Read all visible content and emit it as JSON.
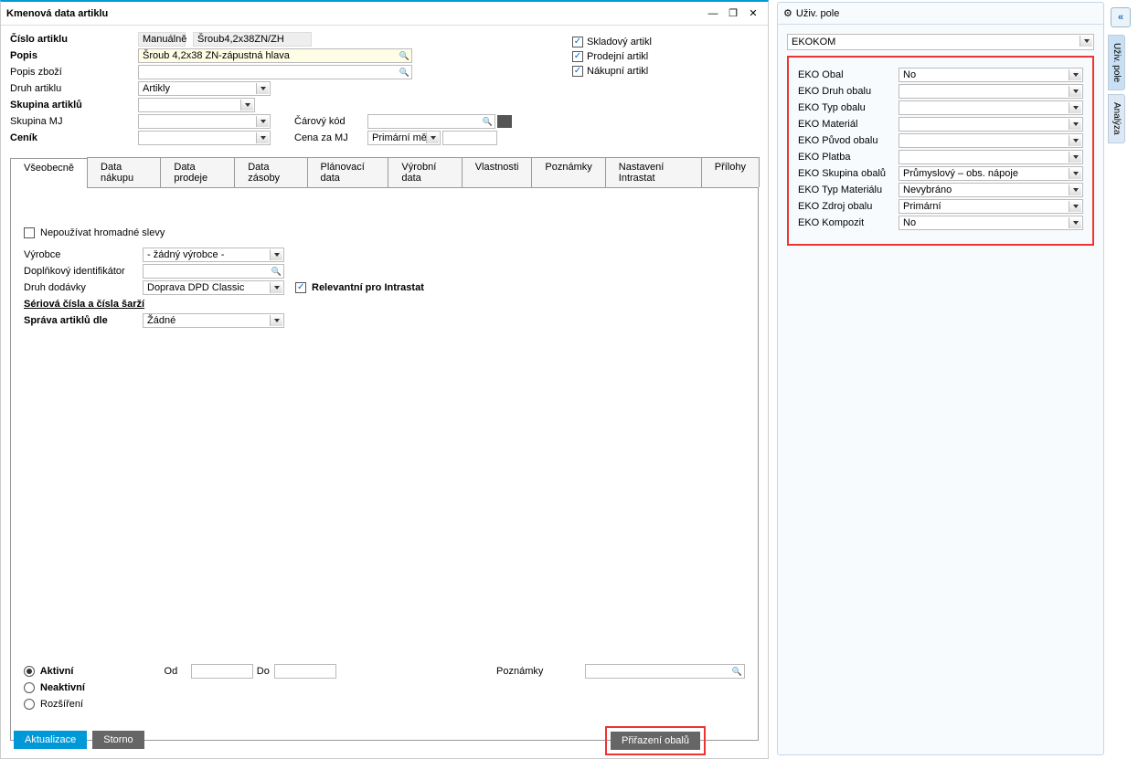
{
  "window": {
    "title": "Kmenová data artiklu",
    "minimize": "—",
    "restore": "❐",
    "close": "✕"
  },
  "fields": {
    "cislo_artiklu_lbl": "Číslo artiklu",
    "cislo_mode": "Manuálně",
    "cislo_value": "Šroub4,2x38ZN/ZH",
    "popis_lbl": "Popis",
    "popis_value": "Šroub 4,2x38 ZN-zápustná hlava",
    "popis_zbozi_lbl": "Popis zboží",
    "druh_artiklu_lbl": "Druh artiklu",
    "druh_artiklu_value": "Artikly",
    "skupina_artiklu_lbl": "Skupina artiklů",
    "skupina_mj_lbl": "Skupina MJ",
    "cenik_lbl": "Ceník",
    "carovy_kod_lbl": "Čárový kód",
    "cena_za_mj_lbl": "Cena za MJ",
    "cena_za_mj_value": "Primární měn"
  },
  "flags": {
    "skladovy": "Skladový artikl",
    "prodejni": "Prodejní artikl",
    "nakupni": "Nákupní artikl"
  },
  "tabs": [
    "Všeobecně",
    "Data nákupu",
    "Data prodeje",
    "Data zásoby",
    "Plánovací data",
    "Výrobní data",
    "Vlastnosti",
    "Poznámky",
    "Nastavení Intrastat",
    "Přílohy"
  ],
  "general": {
    "nepouzivat_slevy": "Nepoužívat hromadné slevy",
    "vyrobce_lbl": "Výrobce",
    "vyrobce_value": "- žádný výrobce -",
    "doplnkovy_id_lbl": "Doplňkový identifikátor",
    "druh_dodavky_lbl": "Druh dodávky",
    "druh_dodavky_value": "Doprava DPD Classic",
    "intrastat_chk": "Relevantní pro Intrastat",
    "serie_lbl": "Sériová čísla a čísla šarží",
    "sprava_lbl": "Správa artiklů dle",
    "sprava_value": "Žádné",
    "aktivni": "Aktivní",
    "neaktivni": "Neaktivní",
    "rozsireni": "Rozšíření",
    "od": "Od",
    "do": "Do",
    "poznamky": "Poznámky"
  },
  "buttons": {
    "aktualizace": "Aktualizace",
    "storno": "Storno",
    "prirazeni": "Přiřazení obalů"
  },
  "side": {
    "title": "Uživ. pole",
    "category": "EKOKOM",
    "rows": [
      {
        "lbl": "EKO Obal",
        "val": "No"
      },
      {
        "lbl": "EKO Druh obalu",
        "val": ""
      },
      {
        "lbl": "EKO Typ obalu",
        "val": ""
      },
      {
        "lbl": "EKO Materiál",
        "val": ""
      },
      {
        "lbl": "EKO Původ obalu",
        "val": ""
      },
      {
        "lbl": "EKO Platba",
        "val": ""
      },
      {
        "lbl": "EKO Skupina obalů",
        "val": "Průmyslový – obs. nápoje"
      },
      {
        "lbl": "EKO Typ Materiálu",
        "val": "Nevybráno"
      },
      {
        "lbl": "EKO Zdroj obalu",
        "val": "Primární"
      },
      {
        "lbl": "EKO Kompozit",
        "val": "No"
      }
    ]
  },
  "right_tabs": [
    "Uživ. pole",
    "Analýza"
  ],
  "collapse": "«"
}
